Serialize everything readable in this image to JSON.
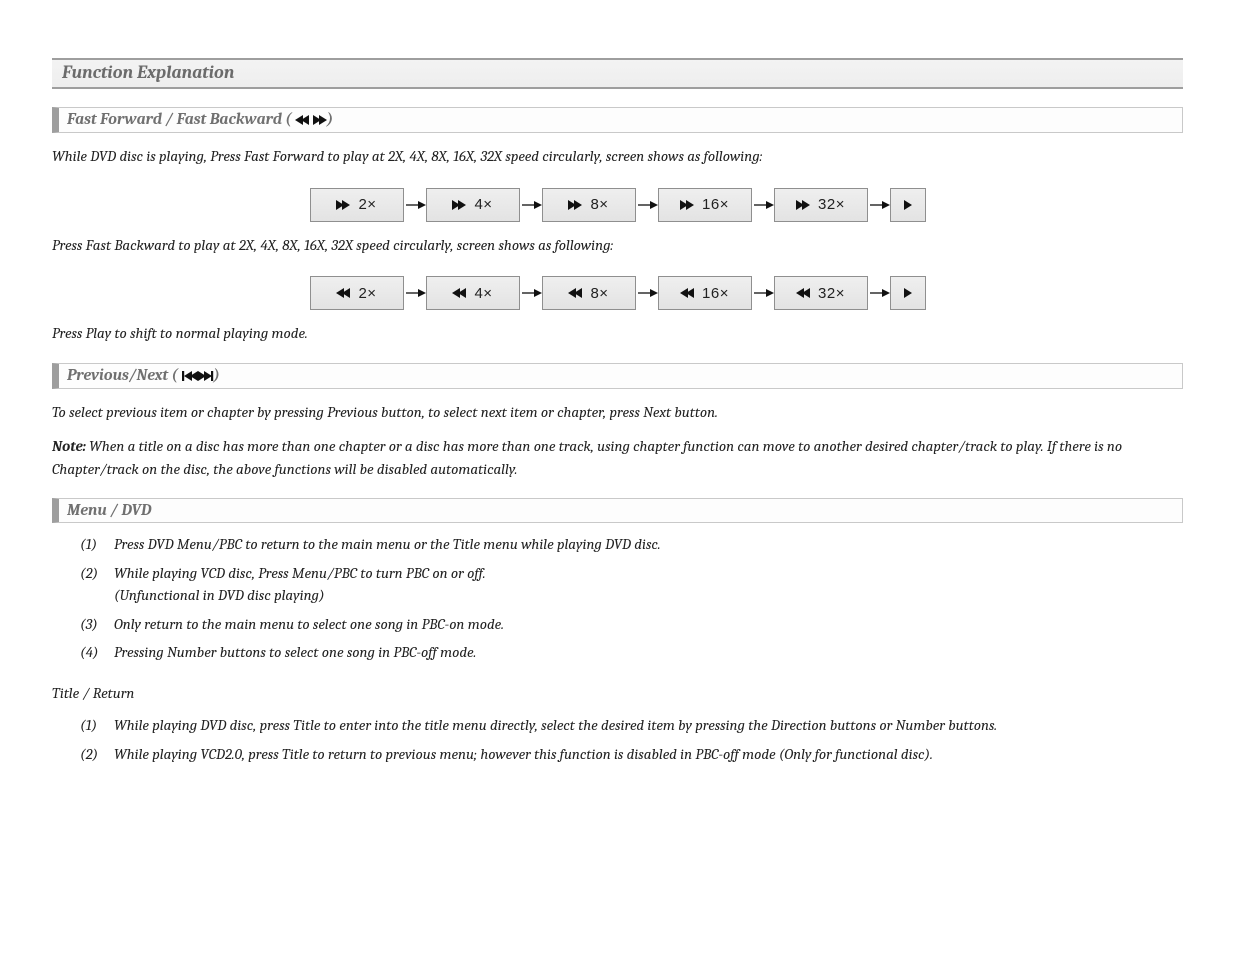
{
  "main_title": "Function Explanation",
  "sec1": {
    "title": "Fast Forward / Fast Backward (",
    "title_after": ")",
    "p1": "While DVD disc is playing, Press Fast Forward to play at 2X, 4X, 8X, 16X, 32X speed circularly, screen shows as following:",
    "ff_speeds": [
      "2×",
      "4×",
      "8×",
      "16×",
      "32×"
    ],
    "p2": "Press Fast Backward to play at 2X, 4X, 8X, 16X, 32X speed circularly, screen shows as following:",
    "fb_speeds": [
      "2×",
      "4×",
      "8×",
      "16×",
      "32×"
    ],
    "p3": "Press Play to shift to normal playing mode."
  },
  "sec2": {
    "title": "Previous/Next (",
    "title_after": ")",
    "p1": "To select previous item or chapter by pressing Previous button, to select next item or chapter, press Next button.",
    "note_label": "Note:",
    "note_body": " When a title on a disc has more than one chapter or a disc has more than one track, using chapter function can move to another desired chapter/track to play. If there is no Chapter/track on the disc, the above functions will be disabled automatically."
  },
  "sec3": {
    "title": "Menu / DVD",
    "items": [
      {
        "num": "(1)",
        "text": "Press DVD Menu/PBC to return to the main menu or the Title menu while playing DVD disc."
      },
      {
        "num": "(2)",
        "text": "While playing VCD disc, Press Menu/PBC to turn PBC on or off.",
        "text2": "(Unfunctional in DVD disc playing)"
      },
      {
        "num": "(3)",
        "text": "Only return to the main menu to select one song in PBC-on mode."
      },
      {
        "num": "(4)",
        "text": "Pressing Number buttons to select one song in PBC-off mode."
      }
    ],
    "title_return": "Title / Return",
    "items2": [
      {
        "num": "(1)",
        "text": "While playing DVD disc, press Title to enter into the title menu directly, select the desired item by pressing the Direction buttons or Number buttons."
      },
      {
        "num": "(2)",
        "text": "While playing VCD2.0, press Title to return to previous menu; however this function is disabled in PBC-off mode (Only for functional disc)."
      }
    ]
  }
}
